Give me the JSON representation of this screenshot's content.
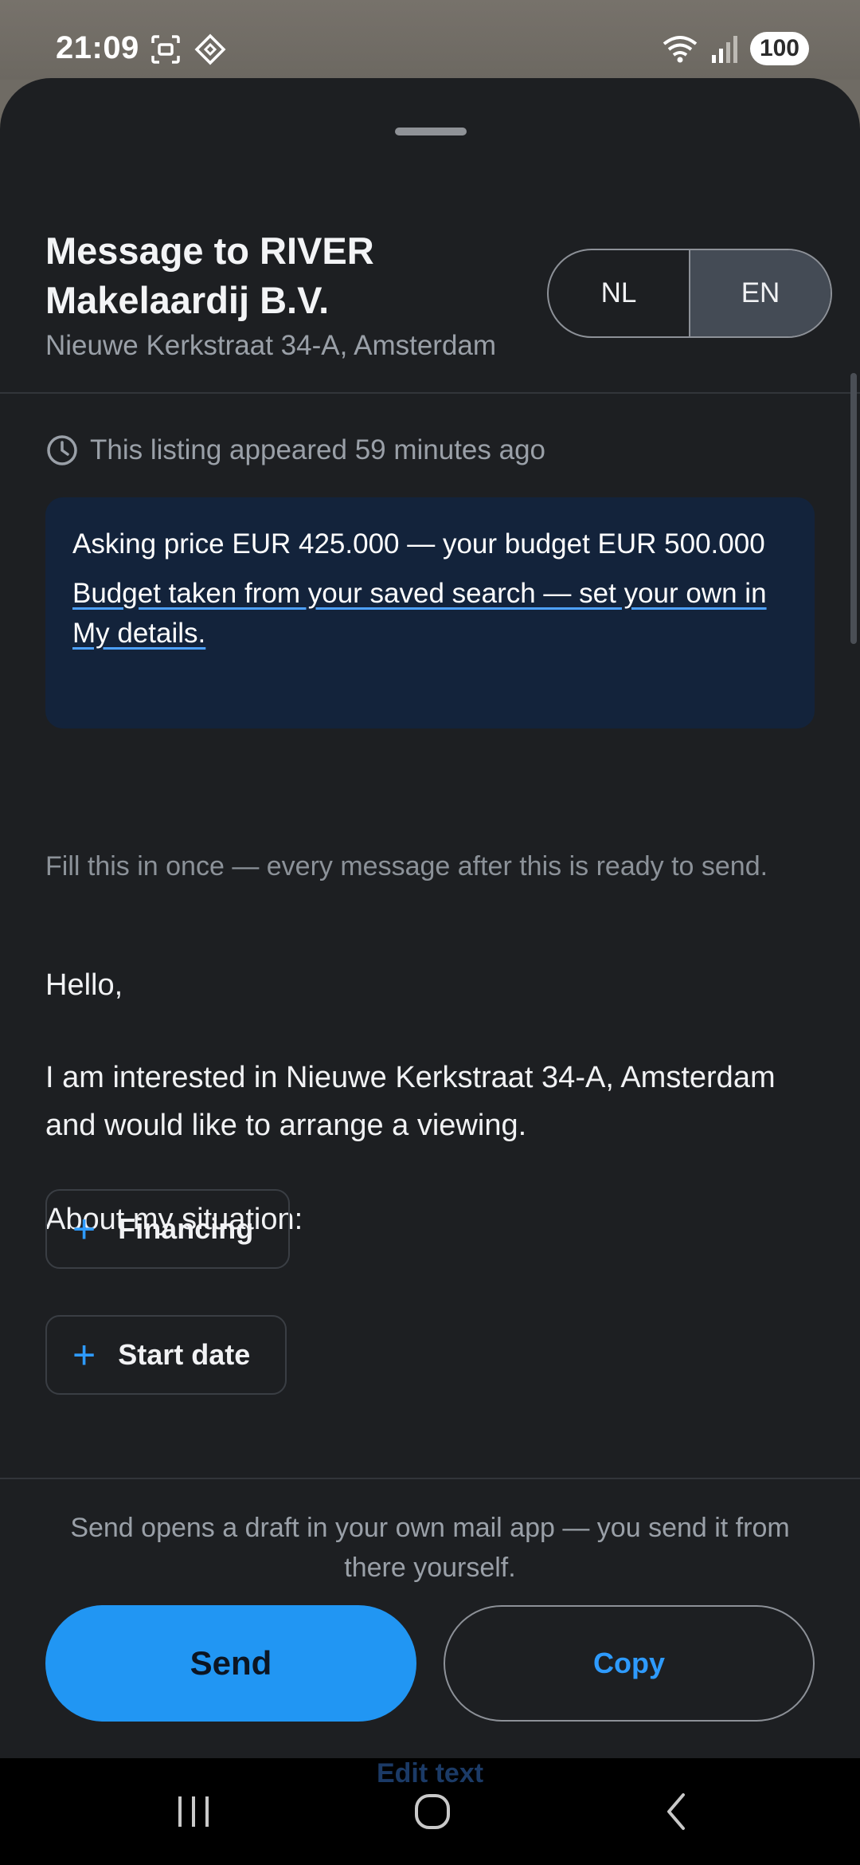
{
  "status_bar": {
    "time": "21:09",
    "battery": "100",
    "icons_left": [
      "screenshot-icon",
      "nfc-diamond-icon"
    ],
    "icons_right": [
      "wifi-icon",
      "signal-icon"
    ]
  },
  "sheet": {
    "title": "Message to RIVER Makelaardij B.V.",
    "subtitle": "Nieuwe Kerkstraat 34-A, Amsterdam",
    "language_toggle": {
      "options": [
        "NL",
        "EN"
      ],
      "selected": "EN"
    }
  },
  "listing_age": "This listing appeared 59 minutes ago",
  "price_card": {
    "price_text": "Asking price EUR 425.000 — your budget EUR 500.000",
    "budget_link": "Budget taken from your saved search — set your own in My details."
  },
  "hint": "Fill this in once — every message after this is ready to send.",
  "message": {
    "greeting": "Hello,",
    "body": "I am interested in Nieuwe Kerkstraat 34-A, Amsterdam and would like to arrange a viewing.",
    "situation_label": "About my situation:",
    "chips": [
      "Financing",
      "Start date"
    ]
  },
  "footer": {
    "note": "Send opens a draft in your own mail app — you send it from there yourself.",
    "send_label": "Send",
    "copy_label": "Copy",
    "edit_label": "Edit text"
  },
  "colors": {
    "accent": "#2196f3",
    "sheet_bg": "#1d1f22",
    "card_bg": "#13233b"
  }
}
